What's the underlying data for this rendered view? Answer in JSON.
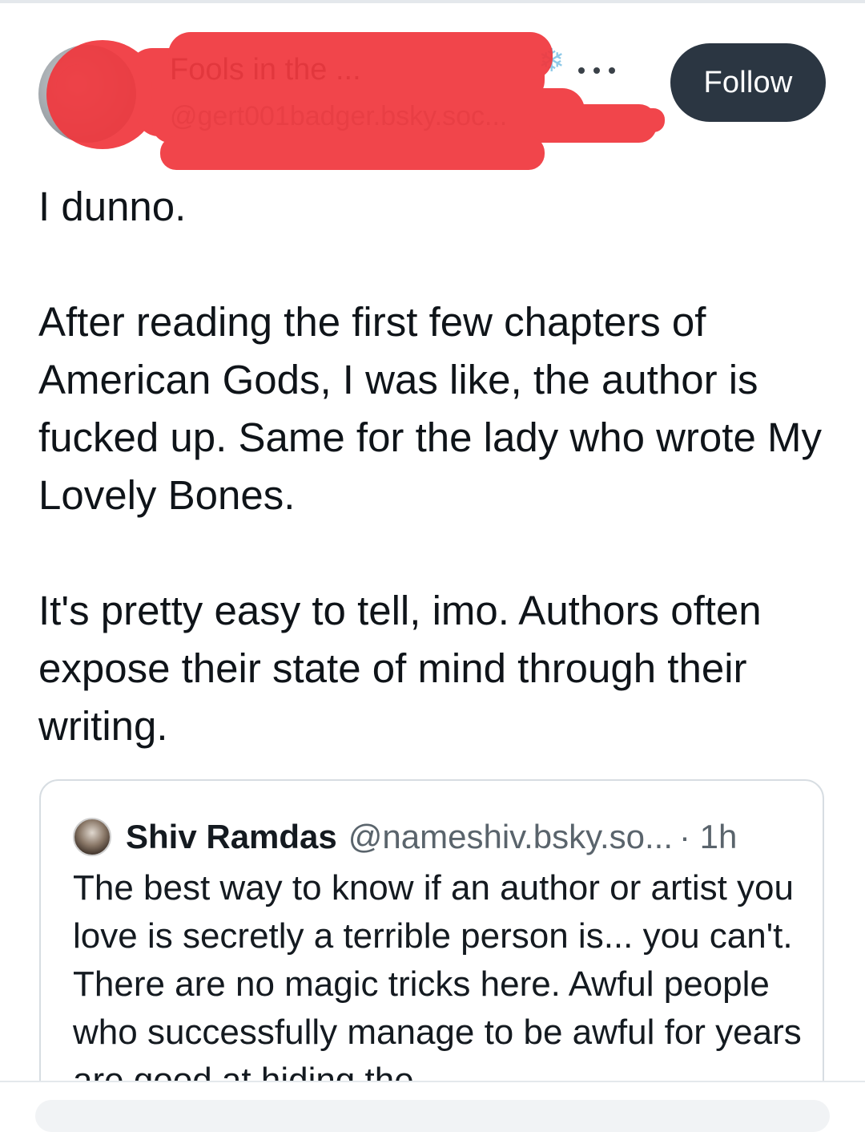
{
  "post": {
    "author": {
      "display_name": "Fools in the ...",
      "handle": "@gert001badger.bsky.soc...",
      "emoji_icon": "snowflake-icon"
    },
    "follow_label": "Follow",
    "more_label": "···",
    "body": [
      "I dunno.",
      "After reading the first few chapters of American Gods, I was like, the author is fucked up. Same for the lady who wrote My Lovely Bones.",
      "It's pretty easy to tell, imo. Authors often expose their state of mind through their writing."
    ]
  },
  "quote": {
    "display_name": "Shiv Ramdas",
    "handle": "@nameshiv.bsky.so...",
    "time": "· 1h",
    "text": "The best way to know if an author or artist you love is secretly a terrible person is... you can't. There are no magic tricks here. Awful people who successfully manage to be awful for years are good at hiding the"
  },
  "colors": {
    "follow_button_bg": "#2b3642",
    "redaction": "#f0383e",
    "border": "#d7dde2"
  }
}
